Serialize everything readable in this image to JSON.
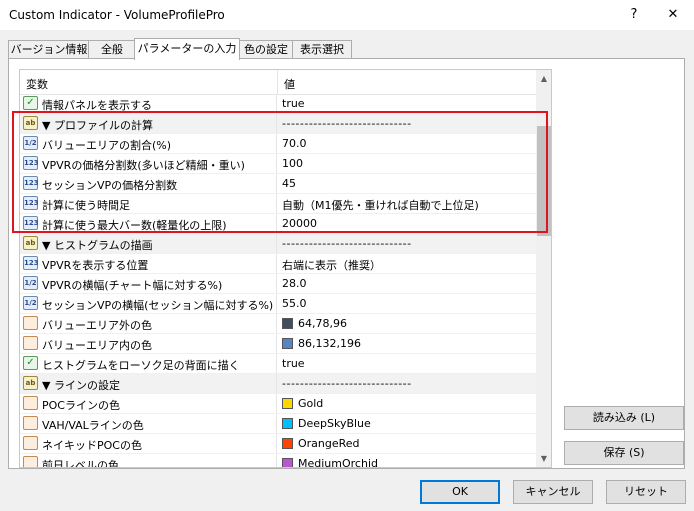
{
  "window": {
    "title": "Custom Indicator - VolumeProfilePro",
    "help_label": "?",
    "close_label": "✕"
  },
  "tabs": [
    {
      "label": "バージョン情報"
    },
    {
      "label": "全般"
    },
    {
      "label": "パラメーターの入力"
    },
    {
      "label": "色の設定"
    },
    {
      "label": "表示選択"
    }
  ],
  "grid": {
    "col_name": "変数",
    "col_value": "値",
    "rows": [
      {
        "icon": "bool",
        "name": "情報パネルを表示する",
        "value": "true"
      },
      {
        "icon": "str",
        "name": "▼ プロファイルの計算",
        "value": "-----------------------------",
        "group": true
      },
      {
        "icon": "dbl",
        "name": "バリューエリアの割合(%)",
        "value": "70.0"
      },
      {
        "icon": "int",
        "name": "VPVRの価格分割数(多いほど精細・重い)",
        "value": "100"
      },
      {
        "icon": "int",
        "name": "セッションVPの価格分割数",
        "value": "45"
      },
      {
        "icon": "int",
        "name": "計算に使う時間足",
        "value": "自動（M1優先・重ければ自動で上位足)"
      },
      {
        "icon": "int",
        "name": "計算に使う最大バー数(軽量化の上限)",
        "value": "20000"
      },
      {
        "icon": "str",
        "name": "▼ ヒストグラムの描画",
        "value": "-----------------------------",
        "group": true
      },
      {
        "icon": "int",
        "name": "VPVRを表示する位置",
        "value": "右端に表示（推奨）"
      },
      {
        "icon": "dbl",
        "name": "VPVRの横幅(チャート幅に対する%)",
        "value": "28.0"
      },
      {
        "icon": "dbl",
        "name": "セッションVPの横幅(セッション幅に対する%)",
        "value": "55.0"
      },
      {
        "icon": "col",
        "name": "バリューエリア外の色",
        "value": "64,78,96",
        "color": "#404e60"
      },
      {
        "icon": "col",
        "name": "バリューエリア内の色",
        "value": "86,132,196",
        "color": "#5684c4"
      },
      {
        "icon": "bool",
        "name": "ヒストグラムをローソク足の背面に描く",
        "value": "true"
      },
      {
        "icon": "str",
        "name": "▼ ラインの設定",
        "value": "-----------------------------",
        "group": true
      },
      {
        "icon": "col",
        "name": "POCラインの色",
        "value": "Gold",
        "color": "#ffd700"
      },
      {
        "icon": "col",
        "name": "VAH/VALラインの色",
        "value": "DeepSkyBlue",
        "color": "#00bfff"
      },
      {
        "icon": "col",
        "name": "ネイキッドPOCの色",
        "value": "OrangeRed",
        "color": "#ff4500"
      },
      {
        "icon": "col",
        "name": "前日レベルの色",
        "value": "MediumOrchid",
        "color": "#ba55d3"
      }
    ]
  },
  "buttons": {
    "load": "読み込み (L)",
    "save": "保存 (S)",
    "ok": "OK",
    "cancel": "キャンセル",
    "reset": "リセット"
  },
  "icons": {
    "bool": "✓",
    "str": "ab",
    "dbl": "1/2",
    "int": "123",
    "col": ""
  },
  "colors": {
    "highlight": "#e0141e",
    "accent": "#0078d7"
  }
}
